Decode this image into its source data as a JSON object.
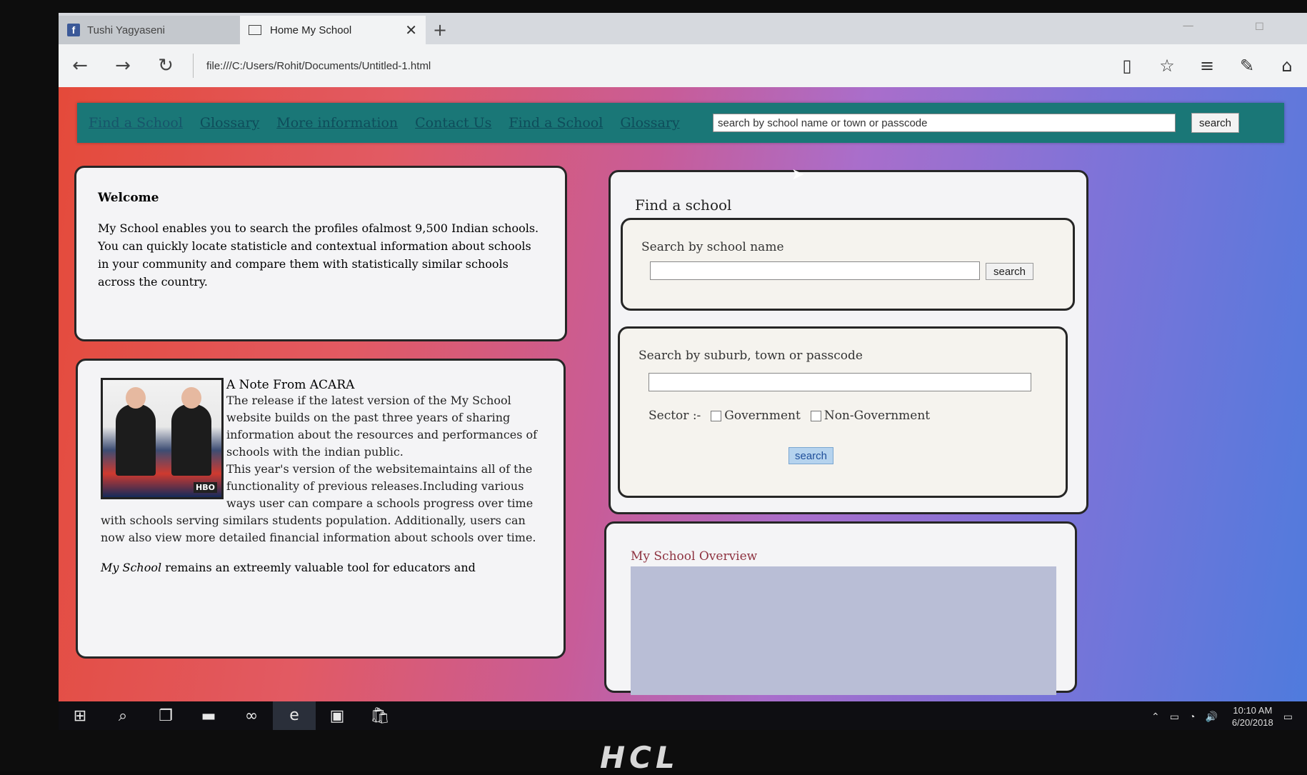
{
  "browser": {
    "tabs": [
      {
        "label": "Tushi Yagyaseni",
        "icon": "facebook-icon"
      },
      {
        "label": "Home My School",
        "icon": "page-icon"
      }
    ],
    "url": "file:///C:/Users/Rohit/Documents/Untitled-1.html"
  },
  "page": {
    "nav": [
      "Find a School",
      "Glossary",
      "More information",
      "Contact Us",
      "Find a School",
      "Glossary"
    ],
    "top_search_placeholder": "search by school name or town or passcode",
    "top_search_button": "search",
    "welcome": {
      "title": "Welcome",
      "lines": [
        "My School enables you to search the profiles ofalmost 9,500 Indian schools.",
        "You can quickly locate statisticle and contextual information about schools in your community and compare them with statistically similar schools across the country."
      ]
    },
    "note": {
      "title": "A Note From ACARA",
      "para1": "The release if the latest version of the My School website builds on the past three years of sharing information about the resources and performances of schools with the indian public.",
      "para2": "This year's version of the websitemaintains all of the functionality of previous releases.Including various ways user can compare a schools progress over time with schools serving similars students population. Additionally, users can now also view more detailed financial information about schools over time.",
      "last_italic": "My School",
      "last_rest": " remains an extreemly valuable tool for educators and"
    },
    "find": {
      "title": "Find a school",
      "by_name_label": "Search by school name",
      "by_name_button": "search",
      "by_suburb_label": "Search by suburb, town or passcode",
      "sector_label": "Sector :-",
      "sector_options": [
        "Government",
        "Non-Government"
      ],
      "suburb_button": "search"
    },
    "overview_title": "My School Overview"
  },
  "taskbar": {
    "time": "10:10 AM",
    "date": "6/20/2018"
  },
  "brand": "HCL",
  "colors": {
    "nav_bg": "#1a7777",
    "panel_border": "#262626",
    "overview_title": "#8e3240"
  }
}
